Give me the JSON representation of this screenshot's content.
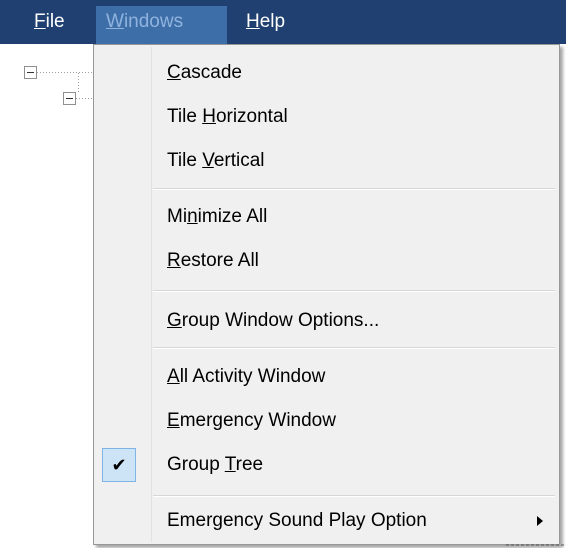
{
  "menubar": {
    "file": {
      "pre": "",
      "u": "F",
      "post": "ile"
    },
    "window": {
      "pre": "",
      "u": "W",
      "post": "indows"
    },
    "help": {
      "pre": "",
      "u": "H",
      "post": "elp"
    }
  },
  "menu": {
    "cascade": {
      "pre": "",
      "u": "C",
      "post": "ascade"
    },
    "tile_h": {
      "pre": "Tile ",
      "u": "H",
      "post": "orizontal"
    },
    "tile_v": {
      "pre": "Tile ",
      "u": "V",
      "post": "ertical"
    },
    "minimize": {
      "pre": "Mi",
      "u": "n",
      "post": "imize All"
    },
    "restore": {
      "pre": "",
      "u": "R",
      "post": "estore All"
    },
    "group_opts": {
      "pre": "",
      "u": "G",
      "post": "roup Window Options..."
    },
    "all_activity": {
      "pre": "",
      "u": "A",
      "post": "ll Activity Window"
    },
    "emergency": {
      "pre": "",
      "u": "E",
      "post": "mergency Window"
    },
    "group_tree": {
      "pre": "Group ",
      "u": "T",
      "post": "ree",
      "checked": true,
      "check_glyph": "✔"
    },
    "sound": {
      "pre": "Emergency Sound Play Option",
      "u": "",
      "post": ""
    }
  },
  "tree": {
    "expand_glyph": "⊟"
  },
  "colors": {
    "menubar_bg": "#1f4070",
    "active_item_bg": "#3e6ea8",
    "menu_bg": "#f0f0f0",
    "check_bg": "#cde4f7"
  }
}
